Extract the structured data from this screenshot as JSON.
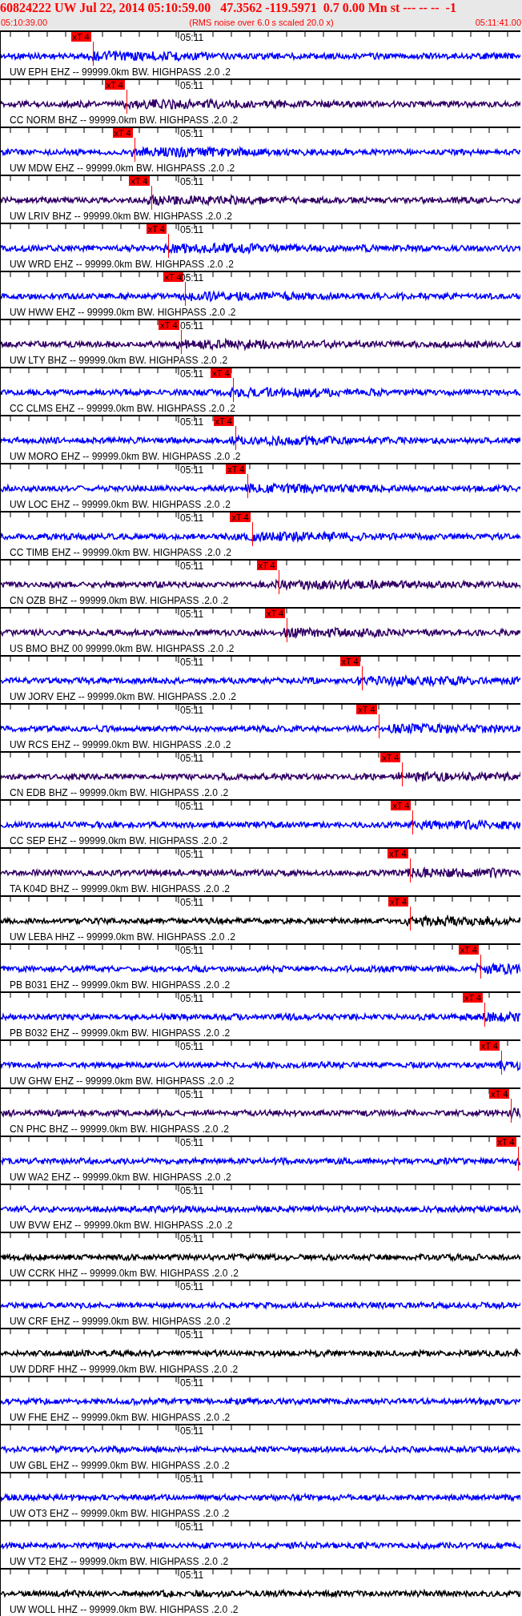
{
  "header": {
    "title": "60824222 UW Jul 22, 2014 05:10:59.00   47.3562 -119.5971  0.7 0.00 Mn st --- -- --  -1",
    "start_time": "05:10:39.00",
    "note": "(RMS noise over 6.0 s scaled 20.0 x)",
    "end_time": "05:11:41.00"
  },
  "traces": [
    {
      "label": "UW EPH EHZ -- 99999.0km BW. HIGHPASS .2.0 .2",
      "time": "05:11",
      "color": "#0000ff",
      "pick": {
        "label": "xT 4",
        "level": 0.178
      }
    },
    {
      "label": "CC NORM BHZ -- 99999.0km BW. HIGHPASS .2.0 .2",
      "time": "05:11",
      "color": "#330066",
      "pick": {
        "label": "xT 4",
        "level": 0.243
      }
    },
    {
      "label": "UW MDW EHZ -- 99999.0km BW. HIGHPASS .2.0 .2",
      "time": "05:11",
      "color": "#0000ff",
      "pick": {
        "label": "xT 4",
        "level": 0.258
      }
    },
    {
      "label": "UW LRIV BHZ -- 99999.0km BW. HIGHPASS .2.0 .2",
      "time": "05:11",
      "color": "#330066",
      "pick": {
        "label": "xT 4",
        "level": 0.29
      }
    },
    {
      "label": "UW WRD EHZ -- 99999.0km BW. HIGHPASS .2.0 .2",
      "time": "05:11",
      "color": "#0000ff",
      "pick": {
        "label": "xT 4",
        "level": 0.323
      }
    },
    {
      "label": "UW HWW EHZ -- 99999.0km BW. HIGHPASS .2.0 .2",
      "time": "05:11",
      "color": "#0000ff",
      "pick": {
        "label": "xT 4",
        "level": 0.355
      }
    },
    {
      "label": "UW LTY BHZ -- 99999.0km BW. HIGHPASS .2.0 .2",
      "time": "05:11",
      "color": "#330066",
      "pick": {
        "label": "xT 4",
        "level": 0.347
      }
    },
    {
      "label": "CC CLMS EHZ -- 99999.0km BW. HIGHPASS .2.0 .2",
      "time": "05:11",
      "color": "#0000ff",
      "pick": {
        "label": "xT 4",
        "level": 0.447
      }
    },
    {
      "label": "UW MORO EHZ -- 99999.0km BW. HIGHPASS .2.0 .2",
      "time": "05:11",
      "color": "#0000ff",
      "pick": {
        "label": "xT 4",
        "level": 0.452
      }
    },
    {
      "label": "UW LOC EHZ -- 99999.0km BW. HIGHPASS .2.0 .2",
      "time": "05:11",
      "color": "#0000ff",
      "pick": {
        "label": "xT 4",
        "level": 0.476
      }
    },
    {
      "label": "CC TIMB EHZ -- 99999.0km BW. HIGHPASS .2.0 .2",
      "time": "05:11",
      "color": "#0000ff",
      "pick": {
        "label": "xT 4",
        "level": 0.484
      }
    },
    {
      "label": "CN OZB BHZ -- 99999.0km BW. HIGHPASS .2.0 .2",
      "time": "05:11",
      "color": "#330066",
      "pick": {
        "label": "xT 4",
        "level": 0.535
      }
    },
    {
      "label": "US BMO BHZ 00 99999.0km BW. HIGHPASS .2.0 .2",
      "time": "05:11",
      "color": "#330066",
      "pick": {
        "label": "xT 4",
        "level": 0.551
      }
    },
    {
      "label": "UW JORV EHZ -- 99999.0km BW. HIGHPASS .2.0 .2",
      "time": "05:11",
      "color": "#0000ff",
      "pick": {
        "label": "xT 4",
        "level": 0.695
      }
    },
    {
      "label": "UW RCS EHZ -- 99999.0km BW. HIGHPASS .2.0 .2",
      "time": "05:11",
      "color": "#0000ff",
      "pick": {
        "label": "xT 4",
        "level": 0.727
      }
    },
    {
      "label": "CN EDB BHZ -- 99999.0km BW. HIGHPASS .2.0 .2",
      "time": "05:11",
      "color": "#330066",
      "pick": {
        "label": "xT 4",
        "level": 0.773
      }
    },
    {
      "label": "CC SEP EHZ -- 99999.0km BW. HIGHPASS .2.0 .2",
      "time": "05:11",
      "color": "#0000ff",
      "pick": {
        "label": "xT 4",
        "level": 0.793
      }
    },
    {
      "label": "TA K04D BHZ -- 99999.0km BW. HIGHPASS .2.0 .2",
      "time": "05:11",
      "color": "#330066",
      "pick": {
        "label": "xT 4",
        "level": 0.787
      }
    },
    {
      "label": "UW LEBA HHZ -- 99999.0km BW. HIGHPASS .2.0 .2",
      "time": "05:11",
      "color": "#000000",
      "pick": {
        "label": "xT 4",
        "level": 0.788
      }
    },
    {
      "label": "PB B031 EHZ -- 99999.0km BW. HIGHPASS .2.0 .2",
      "time": "05:11",
      "color": "#0000ff",
      "pick": {
        "label": "xT 4",
        "level": 0.923
      }
    },
    {
      "label": "PB B032 EHZ -- 99999.0km BW. HIGHPASS .2.0 .2",
      "time": "05:11",
      "color": "#0000ff",
      "pick": {
        "label": "xT 4",
        "level": 0.931
      }
    },
    {
      "label": "UW GHW EHZ -- 99999.0km BW. HIGHPASS .2.0 .2",
      "time": "05:11",
      "color": "#0000ff",
      "pick": {
        "label": "xT 4",
        "level": 0.963
      }
    },
    {
      "label": "CN PHC BHZ -- 99999.0km BW. HIGHPASS .2.0 .2",
      "time": "05:11",
      "color": "#330066",
      "pick": {
        "label": "xT 4",
        "level": 0.982
      }
    },
    {
      "label": "UW WA2 EHZ -- 99999.0km BW. HIGHPASS .2.0 .2",
      "time": "05:11",
      "color": "#0000ff",
      "pick": {
        "label": "xT 4",
        "level": 0.995
      }
    },
    {
      "label": "UW BVW EHZ -- 99999.0km BW. HIGHPASS .2.0 .2",
      "time": "05:11",
      "color": "#0000ff"
    },
    {
      "label": "UW CCRK HHZ -- 99999.0km BW. HIGHPASS .2.0 .2",
      "time": "05:11",
      "color": "#000000"
    },
    {
      "label": "UW CRF EHZ -- 99999.0km BW. HIGHPASS .2.0 .2",
      "time": "05:11",
      "color": "#0000ff"
    },
    {
      "label": "UW DDRF HHZ -- 99999.0km BW. HIGHPASS .2.0 .2",
      "time": "05:11",
      "color": "#000000"
    },
    {
      "label": "UW FHE EHZ -- 99999.0km BW. HIGHPASS .2.0 .2",
      "time": "05:11",
      "color": "#0000ff"
    },
    {
      "label": "UW GBL EHZ -- 99999.0km BW. HIGHPASS .2.0 .2",
      "time": "05:11",
      "color": "#0000ff"
    },
    {
      "label": "UW OT3 EHZ -- 99999.0km BW. HIGHPASS .2.0 .2",
      "time": "05:11",
      "color": "#0000ff"
    },
    {
      "label": "UW VT2 EHZ -- 99999.0km BW. HIGHPASS .2.0 .2",
      "time": "05:11",
      "color": "#0000ff"
    },
    {
      "label": "UW WOLL HHZ -- 99999.0km BW. HIGHPASS .2.0 .2",
      "time": "05:11",
      "color": "#000000"
    }
  ]
}
